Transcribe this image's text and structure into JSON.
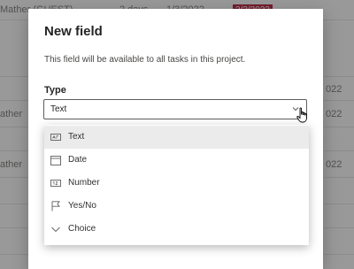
{
  "background": {
    "row1": {
      "name": "Mather (GUEST)",
      "duration": "2 days",
      "start": "1/3/2022",
      "due": "2/3/2022"
    },
    "row2_date": "022",
    "row3": {
      "name": "ather",
      "date": "022"
    },
    "row4": {
      "name": "ather",
      "date": "022"
    }
  },
  "dialog": {
    "title": "New field",
    "description": "This field will be available to all tasks in this project.",
    "type_label": "Type",
    "type_value": "Text"
  },
  "options": [
    {
      "label": "Text",
      "icon": "text-field-icon",
      "selected": true
    },
    {
      "label": "Date",
      "icon": "calendar-icon",
      "selected": false
    },
    {
      "label": "Number",
      "icon": "number-icon",
      "selected": false
    },
    {
      "label": "Yes/No",
      "icon": "flag-icon",
      "selected": false
    },
    {
      "label": "Choice",
      "icon": "chevron-down-icon",
      "selected": false
    }
  ],
  "colors": {
    "due_badge": "#c4314b",
    "overlay": "rgba(0,0,0,0.40)",
    "selected_option": "#ebebeb"
  }
}
